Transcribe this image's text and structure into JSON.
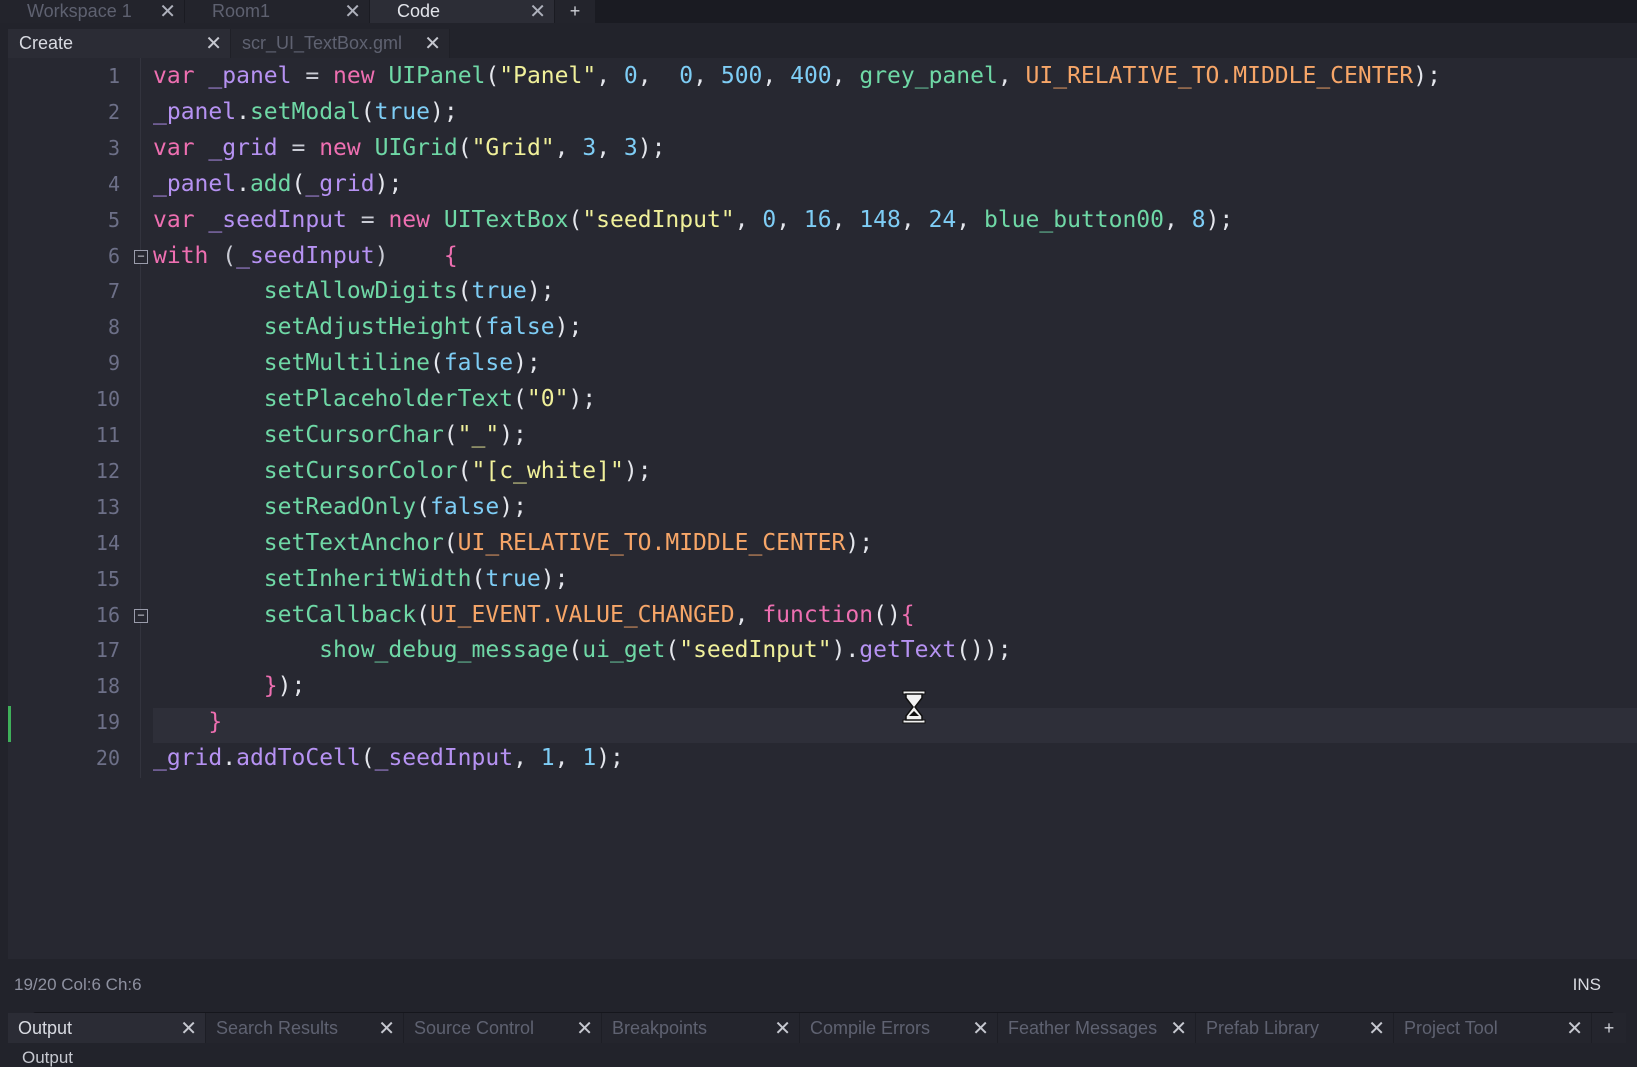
{
  "workspace_tabs": [
    {
      "label": "Workspace 1",
      "active": false
    },
    {
      "label": "Room1",
      "active": false
    },
    {
      "label": "Code",
      "active": true
    }
  ],
  "workspace_add": "+",
  "file_tabs": [
    {
      "label": "Create",
      "active": true
    },
    {
      "label": "scr_UI_TextBox.gml",
      "active": false
    }
  ],
  "close_glyph": "✕",
  "code_lines": [
    {
      "n": "1",
      "tokens": [
        [
          "kw",
          "var"
        ],
        [
          "plain",
          " "
        ],
        [
          "var",
          "_panel"
        ],
        [
          "plain",
          " = "
        ],
        [
          "kw",
          "new"
        ],
        [
          "plain",
          " "
        ],
        [
          "fn",
          "UIPanel"
        ],
        [
          "punc",
          "("
        ],
        [
          "str",
          "\"Panel\""
        ],
        [
          "punc",
          ", "
        ],
        [
          "num",
          "0"
        ],
        [
          "punc",
          ",  "
        ],
        [
          "num",
          "0"
        ],
        [
          "punc",
          ", "
        ],
        [
          "num",
          "500"
        ],
        [
          "punc",
          ", "
        ],
        [
          "num",
          "400"
        ],
        [
          "punc",
          ", "
        ],
        [
          "fn",
          "grey_panel"
        ],
        [
          "punc",
          ", "
        ],
        [
          "const",
          "UI_RELATIVE_TO.MIDDLE_CENTER"
        ],
        [
          "punc",
          ");"
        ]
      ]
    },
    {
      "n": "2",
      "tokens": [
        [
          "var",
          "_panel"
        ],
        [
          "punc",
          "."
        ],
        [
          "fn",
          "setModal"
        ],
        [
          "punc",
          "("
        ],
        [
          "num",
          "true"
        ],
        [
          "punc",
          ");"
        ]
      ]
    },
    {
      "n": "3",
      "tokens": [
        [
          "kw",
          "var"
        ],
        [
          "plain",
          " "
        ],
        [
          "var",
          "_grid"
        ],
        [
          "plain",
          " = "
        ],
        [
          "kw",
          "new"
        ],
        [
          "plain",
          " "
        ],
        [
          "fn",
          "UIGrid"
        ],
        [
          "punc",
          "("
        ],
        [
          "str",
          "\"Grid\""
        ],
        [
          "punc",
          ", "
        ],
        [
          "num",
          "3"
        ],
        [
          "punc",
          ", "
        ],
        [
          "num",
          "3"
        ],
        [
          "punc",
          ");"
        ]
      ]
    },
    {
      "n": "4",
      "tokens": [
        [
          "var",
          "_panel"
        ],
        [
          "punc",
          "."
        ],
        [
          "fn",
          "add"
        ],
        [
          "punc",
          "("
        ],
        [
          "var",
          "_grid"
        ],
        [
          "punc",
          ");"
        ]
      ]
    },
    {
      "n": "5",
      "tokens": [
        [
          "kw",
          "var"
        ],
        [
          "plain",
          " "
        ],
        [
          "var",
          "_seedInput"
        ],
        [
          "plain",
          " = "
        ],
        [
          "kw",
          "new"
        ],
        [
          "plain",
          " "
        ],
        [
          "fn",
          "UITextBox"
        ],
        [
          "punc",
          "("
        ],
        [
          "str",
          "\"seedInput\""
        ],
        [
          "punc",
          ", "
        ],
        [
          "num",
          "0"
        ],
        [
          "punc",
          ", "
        ],
        [
          "num",
          "16"
        ],
        [
          "punc",
          ", "
        ],
        [
          "num",
          "148"
        ],
        [
          "punc",
          ", "
        ],
        [
          "num",
          "24"
        ],
        [
          "punc",
          ", "
        ],
        [
          "fn",
          "blue_button00"
        ],
        [
          "punc",
          ", "
        ],
        [
          "num",
          "8"
        ],
        [
          "punc",
          ");"
        ]
      ]
    },
    {
      "n": "6",
      "fold": true,
      "tokens": [
        [
          "kw",
          "with"
        ],
        [
          "plain",
          " ("
        ],
        [
          "var",
          "_seedInput"
        ],
        [
          "plain",
          ")    "
        ],
        [
          "brace",
          "{"
        ]
      ]
    },
    {
      "n": "7",
      "tokens": [
        [
          "plain",
          "        "
        ],
        [
          "fn",
          "setAllowDigits"
        ],
        [
          "punc",
          "("
        ],
        [
          "num",
          "true"
        ],
        [
          "punc",
          ");"
        ]
      ]
    },
    {
      "n": "8",
      "tokens": [
        [
          "plain",
          "        "
        ],
        [
          "fn",
          "setAdjustHeight"
        ],
        [
          "punc",
          "("
        ],
        [
          "num",
          "false"
        ],
        [
          "punc",
          ");"
        ]
      ]
    },
    {
      "n": "9",
      "tokens": [
        [
          "plain",
          "        "
        ],
        [
          "fn",
          "setMultiline"
        ],
        [
          "punc",
          "("
        ],
        [
          "num",
          "false"
        ],
        [
          "punc",
          ");"
        ]
      ]
    },
    {
      "n": "10",
      "tokens": [
        [
          "plain",
          "        "
        ],
        [
          "fn",
          "setPlaceholderText"
        ],
        [
          "punc",
          "("
        ],
        [
          "str",
          "\"0\""
        ],
        [
          "punc",
          ");"
        ]
      ]
    },
    {
      "n": "11",
      "tokens": [
        [
          "plain",
          "        "
        ],
        [
          "fn",
          "setCursorChar"
        ],
        [
          "punc",
          "("
        ],
        [
          "str",
          "\"_\""
        ],
        [
          "punc",
          ");"
        ]
      ]
    },
    {
      "n": "12",
      "tokens": [
        [
          "plain",
          "        "
        ],
        [
          "fn",
          "setCursorColor"
        ],
        [
          "punc",
          "("
        ],
        [
          "str",
          "\"[c_white]\""
        ],
        [
          "punc",
          ");"
        ]
      ]
    },
    {
      "n": "13",
      "tokens": [
        [
          "plain",
          "        "
        ],
        [
          "fn",
          "setReadOnly"
        ],
        [
          "punc",
          "("
        ],
        [
          "num",
          "false"
        ],
        [
          "punc",
          ");"
        ]
      ]
    },
    {
      "n": "14",
      "tokens": [
        [
          "plain",
          "        "
        ],
        [
          "fn",
          "setTextAnchor"
        ],
        [
          "punc",
          "("
        ],
        [
          "const",
          "UI_RELATIVE_TO.MIDDLE_CENTER"
        ],
        [
          "punc",
          ");"
        ]
      ]
    },
    {
      "n": "15",
      "tokens": [
        [
          "plain",
          "        "
        ],
        [
          "fn",
          "setInheritWidth"
        ],
        [
          "punc",
          "("
        ],
        [
          "num",
          "true"
        ],
        [
          "punc",
          ");"
        ]
      ]
    },
    {
      "n": "16",
      "fold": true,
      "tokens": [
        [
          "plain",
          "        "
        ],
        [
          "fn",
          "setCallback"
        ],
        [
          "punc",
          "("
        ],
        [
          "const",
          "UI_EVENT.VALUE_CHANGED"
        ],
        [
          "punc",
          ", "
        ],
        [
          "kw",
          "function"
        ],
        [
          "punc",
          "()"
        ],
        [
          "brace",
          "{"
        ]
      ]
    },
    {
      "n": "17",
      "tokens": [
        [
          "plain",
          "            "
        ],
        [
          "fn",
          "show_debug_message"
        ],
        [
          "punc",
          "("
        ],
        [
          "fn",
          "ui_get"
        ],
        [
          "punc",
          "("
        ],
        [
          "str",
          "\"seedInput\""
        ],
        [
          "punc",
          ")."
        ],
        [
          "var",
          "getText"
        ],
        [
          "punc",
          "());"
        ]
      ]
    },
    {
      "n": "18",
      "tokens": [
        [
          "plain",
          "        "
        ],
        [
          "brace",
          "}"
        ],
        [
          "punc",
          ");"
        ]
      ]
    },
    {
      "n": "19",
      "tokens": [
        [
          "plain",
          "    "
        ],
        [
          "brace",
          "}"
        ]
      ]
    },
    {
      "n": "20",
      "tokens": [
        [
          "var",
          "_grid"
        ],
        [
          "punc",
          "."
        ],
        [
          "var",
          "addToCell"
        ],
        [
          "punc",
          "("
        ],
        [
          "var",
          "_seedInput"
        ],
        [
          "punc",
          ", "
        ],
        [
          "num",
          "1"
        ],
        [
          "punc",
          ", "
        ],
        [
          "num",
          "1"
        ],
        [
          "punc",
          ");"
        ]
      ]
    }
  ],
  "status": {
    "position": "19/20 Col:6 Ch:6",
    "mode": "INS"
  },
  "bottom_tabs": [
    {
      "label": "Output",
      "active": true
    },
    {
      "label": "Search Results",
      "active": false
    },
    {
      "label": "Source Control",
      "active": false
    },
    {
      "label": "Breakpoints",
      "active": false
    },
    {
      "label": "Compile Errors",
      "active": false
    },
    {
      "label": "Feather Messages",
      "active": false
    },
    {
      "label": "Prefab Library",
      "active": false
    },
    {
      "label": "Project Tool",
      "active": false
    }
  ],
  "bottom_add": "+",
  "output_peek": "Output",
  "colors": {
    "background": "#22232b",
    "editor": "#272831",
    "keyword": "#ee6fb1",
    "function": "#6fd8a6",
    "string": "#f0f09a",
    "number": "#7ecdf5",
    "constant": "#f7a668",
    "variable": "#b692f2",
    "change_marker": "#3fb05a"
  }
}
